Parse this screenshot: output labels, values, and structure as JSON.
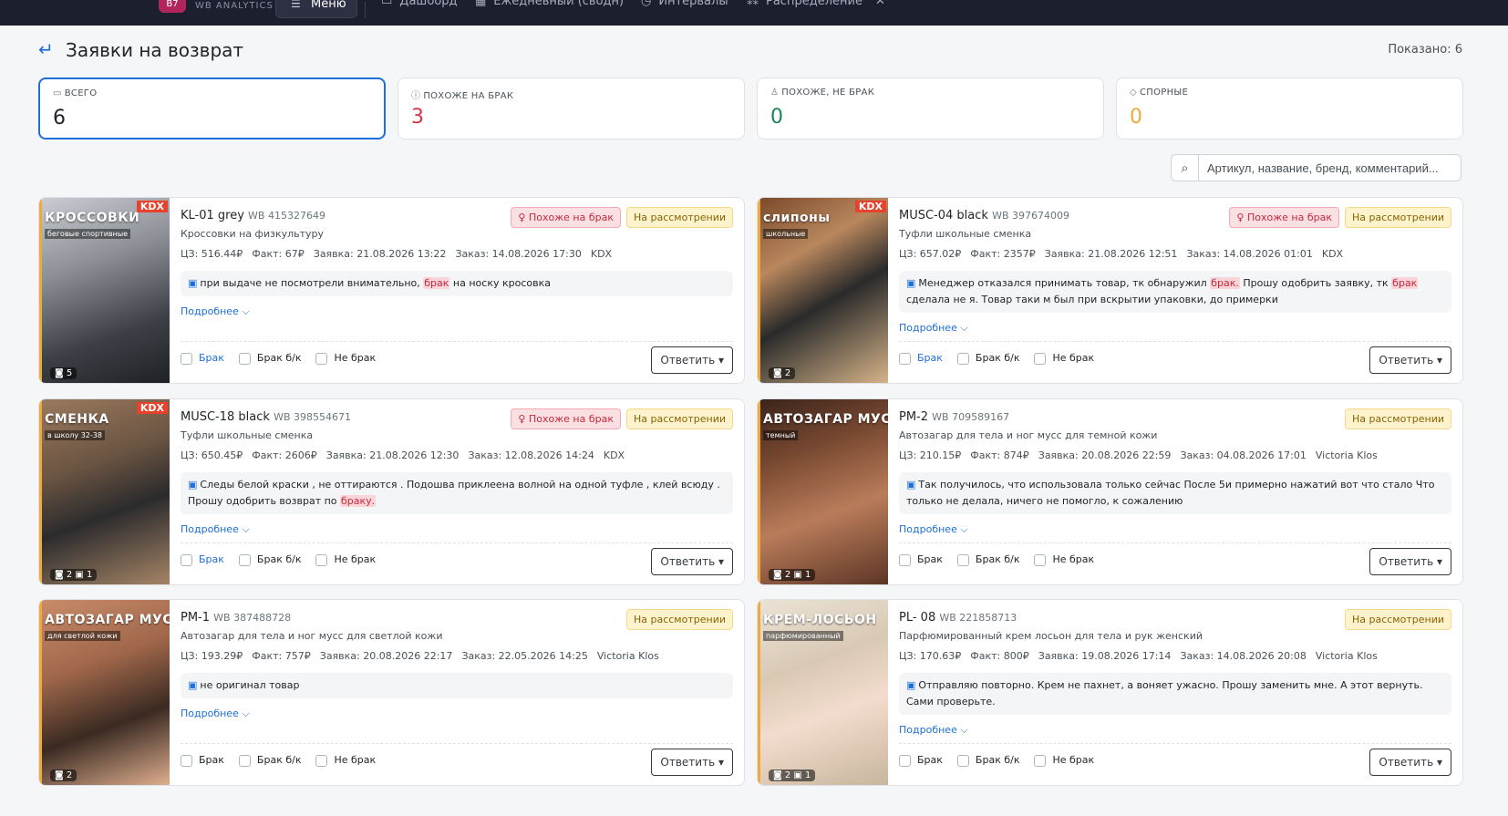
{
  "topbar": {
    "logo_badge": "B7",
    "logo_text": "WB ANALYTICS",
    "menu_label": "Меню",
    "nav": [
      {
        "icon": "▭",
        "label": "Дашборд"
      },
      {
        "icon": "▦",
        "label": "Ежедневный (сводн)"
      },
      {
        "icon": "◷",
        "label": "Интервалы"
      },
      {
        "icon": "⁂",
        "label": "Распределение"
      }
    ],
    "close_glyph": "✕"
  },
  "header": {
    "title": "Заявки на возврат",
    "shown": "Показано: 6"
  },
  "stats": [
    {
      "label": "ВСЕГО",
      "icon": "▭",
      "value": "6",
      "color": "#212529"
    },
    {
      "label": "ПОХОЖЕ НА БРАК",
      "icon": "ⓘ",
      "value": "3",
      "color": "#dc3545"
    },
    {
      "label": "ПОХОЖЕ, НЕ БРАК",
      "icon": "♙",
      "value": "0",
      "color": "#198754"
    },
    {
      "label": "СПОРНЫЕ",
      "icon": "◇",
      "value": "0",
      "color": "#f2a93b"
    }
  ],
  "search": {
    "placeholder": "Артикул, название, бренд, комментарий..."
  },
  "labels": {
    "more": "Подробнее ⌵",
    "reply": "Ответить ▾",
    "check_brak": "Брак",
    "check_brak_bk": "Брак б/к",
    "check_not_brak": "Не брак",
    "badge_brak": "♀ Похоже на брак",
    "badge_review": "На рассмотрении"
  },
  "cards": [
    {
      "name": "KL-01 grey",
      "wb": "WB 415327649",
      "desc": "Кроссовки на физкультуру",
      "cz": "ЦЗ: 516.44₽",
      "fact": "Факт: 67₽",
      "zayavka": "Заявка: 21.08.2026 13:22",
      "zakaz": "Заказ: 14.08.2026 17:30",
      "brand": "KDX",
      "comment": [
        "при выдаче не посмотрели внимательно, ",
        "брак",
        " на носку кросовка"
      ],
      "img_title": "КРОССОВКИ",
      "img_sub": "беговые  спортивные",
      "img_brand": "KDX",
      "img_counts": "◙ 5",
      "img_bg": "linear-gradient(160deg,#c9ccd1 0%,#8c9096 35%,#3d4046 70%,#1e2024 100%)"
    },
    {
      "name": "MUSC-04 black",
      "wb": "WB 397674009",
      "desc": "Туфли школьные сменка",
      "cz": "ЦЗ: 657.02₽",
      "fact": "Факт: 2357₽",
      "zayavka": "Заявка: 21.08.2026 12:51",
      "zakaz": "Заказ: 14.08.2026 01:01",
      "brand": "KDX",
      "comment": [
        "Менеджер отказался принимать товар, тк обнаружил ",
        "брак.",
        " Прошу одобрить заявку, тк ",
        "брак",
        " сделала не я. Товар таки м был при вскрытии упаковки, до примерки"
      ],
      "img_title": "слипоны",
      "img_sub": "школьные",
      "img_brand": "KDX",
      "img_counts": "◙ 2",
      "img_bg": "linear-gradient(150deg,#7a4a2c 0%,#b9875d 30%,#2a2a2a 55%,#d8b58a 100%)"
    },
    {
      "name": "MUSC-18 black",
      "wb": "WB 398554671",
      "desc": "Туфли школьные сменка",
      "cz": "ЦЗ: 650.45₽",
      "fact": "Факт: 2606₽",
      "zayavka": "Заявка: 21.08.2026 12:30",
      "zakaz": "Заказ: 12.08.2026 14:24",
      "brand": "KDX",
      "comment": [
        "Следы белой краски , не оттираются . Подошва приклеена волной на одной туфле , клей всюду . Прошу одобрить возврат по ",
        "браку.",
        ""
      ],
      "img_title": "СМЕНКА",
      "img_sub": "в школу  32-38",
      "img_brand": "KDX",
      "img_counts": "◙ 2  ▣ 1",
      "img_bg": "linear-gradient(160deg,#9a7a5e 0%,#6b5442 35%,#2b2b2d 60%,#a88667 100%)"
    },
    {
      "name": "PM-2",
      "wb": "WB 709589167",
      "desc": "Автозагар для тела и ног мусс для темной кожи",
      "cz": "ЦЗ: 210.15₽",
      "fact": "Факт: 874₽",
      "zayavka": "Заявка: 20.08.2026 22:59",
      "zakaz": "Заказ: 04.08.2026 17:01",
      "brand": "Victoria Klos",
      "comment": [
        "Так получилось, что использовала только сейчас После 5и примерно нажатий вот что стало Что только не делала, ничего не помогло, к сожалению"
      ],
      "img_title": "АВТОЗАГАР МУСС",
      "img_sub": "темный",
      "img_brand": "",
      "img_counts": "◙ 2  ▣ 1",
      "img_bg": "linear-gradient(160deg,#3b241a 0%,#7a4a32 30%,#b97c5a 60%,#5a3424 100%)"
    },
    {
      "name": "PM-1",
      "wb": "WB 387488728",
      "desc": "Автозагар для тела и ног мусс для светлой кожи",
      "cz": "ЦЗ: 193.29₽",
      "fact": "Факт: 757₽",
      "zayavka": "Заявка: 20.08.2026 22:17",
      "zakaz": "Заказ: 22.05.2026 14:25",
      "brand": "Victoria Klos",
      "comment": [
        "не оригинал товар"
      ],
      "img_title": "АВТОЗАГАР МУСС",
      "img_sub": "для светлой кожи",
      "img_brand": "",
      "img_counts": "◙ 2",
      "img_bg": "linear-gradient(160deg,#c98c6a 0%,#a0674a 35%,#3a2a22 65%,#e2b190 100%)"
    },
    {
      "name": "PL- 08",
      "wb": "WB 221858713",
      "desc": "Парфюмированный крем лосьон для тела и рук женский",
      "cz": "ЦЗ: 170.63₽",
      "fact": "Факт: 800₽",
      "zayavka": "Заявка: 19.08.2026 17:14",
      "zakaz": "Заказ: 14.08.2026 20:08",
      "brand": "Victoria Klos",
      "comment": [
        "Отправляю повторно. Крем не пахнет, а воняет ужасно. Прошу заменить мне. А этот вернуть. Сами проверьте."
      ],
      "img_title": "КРЕМ-ЛОСЬОН",
      "img_sub": "парфюмированный",
      "img_brand": "",
      "img_counts": "◙ 2  ▣ 1",
      "img_bg": "linear-gradient(160deg,#eae3d6 0%,#d9c9b4 35%,#f3dccd 60%,#c7b59c 100%)"
    }
  ]
}
